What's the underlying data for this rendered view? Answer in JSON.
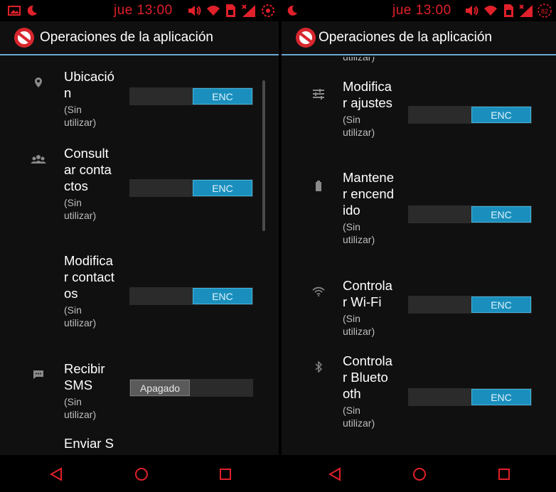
{
  "status_bar": {
    "left_clock": "jue 13:00",
    "right_clock": "jue 13:00",
    "battery_level": "82"
  },
  "action_bar": {
    "title_left": "Operaciones de la aplicación",
    "title_right": "Operaciones de la aplicación"
  },
  "left_list": {
    "items": [
      {
        "label": "Ubicación",
        "sub": "(Sin\nutilizar)",
        "toggle": "ENC",
        "state": "on",
        "icon": "location-pin-icon"
      },
      {
        "label": "Consultar contactos",
        "sub": "(Sin\nutilizar)",
        "toggle": "ENC",
        "state": "on",
        "icon": "contacts-group-icon"
      },
      {
        "label": "Modificar contactos",
        "sub": "(Sin\nutilizar)",
        "toggle": "ENC",
        "state": "on",
        "icon": "none"
      },
      {
        "label": "Recibir SMS",
        "sub": "(Sin\nutilizar)",
        "toggle": "Apagado",
        "state": "off",
        "icon": "sms-message-icon"
      },
      {
        "label": "Enviar SMS",
        "sub": "",
        "toggle": "",
        "state": "",
        "icon": "none"
      }
    ]
  },
  "right_list": {
    "cut_top": "utilizar)",
    "items": [
      {
        "label": "Modificar ajustes",
        "sub": "(Sin\nutilizar)",
        "toggle": "ENC",
        "state": "on",
        "icon": "settings-sliders-icon"
      },
      {
        "label": "Mantener encendido",
        "sub": "(Sin\nutilizar)",
        "toggle": "ENC",
        "state": "on",
        "icon": "battery-icon"
      },
      {
        "label": "Controlar Wi-Fi",
        "sub": "(Sin\nutilizar)",
        "toggle": "ENC",
        "state": "on",
        "icon": "wifi-icon"
      },
      {
        "label": "Controlar Bluetooth",
        "sub": "(Sin\nutilizar)",
        "toggle": "ENC",
        "state": "on",
        "icon": "bluetooth-icon"
      }
    ]
  },
  "colors": {
    "status_red": "#e0202a",
    "toggle_on": "#1a8fbd",
    "toggle_off": "#5a5a5a",
    "divider": "#6aa8d0"
  }
}
